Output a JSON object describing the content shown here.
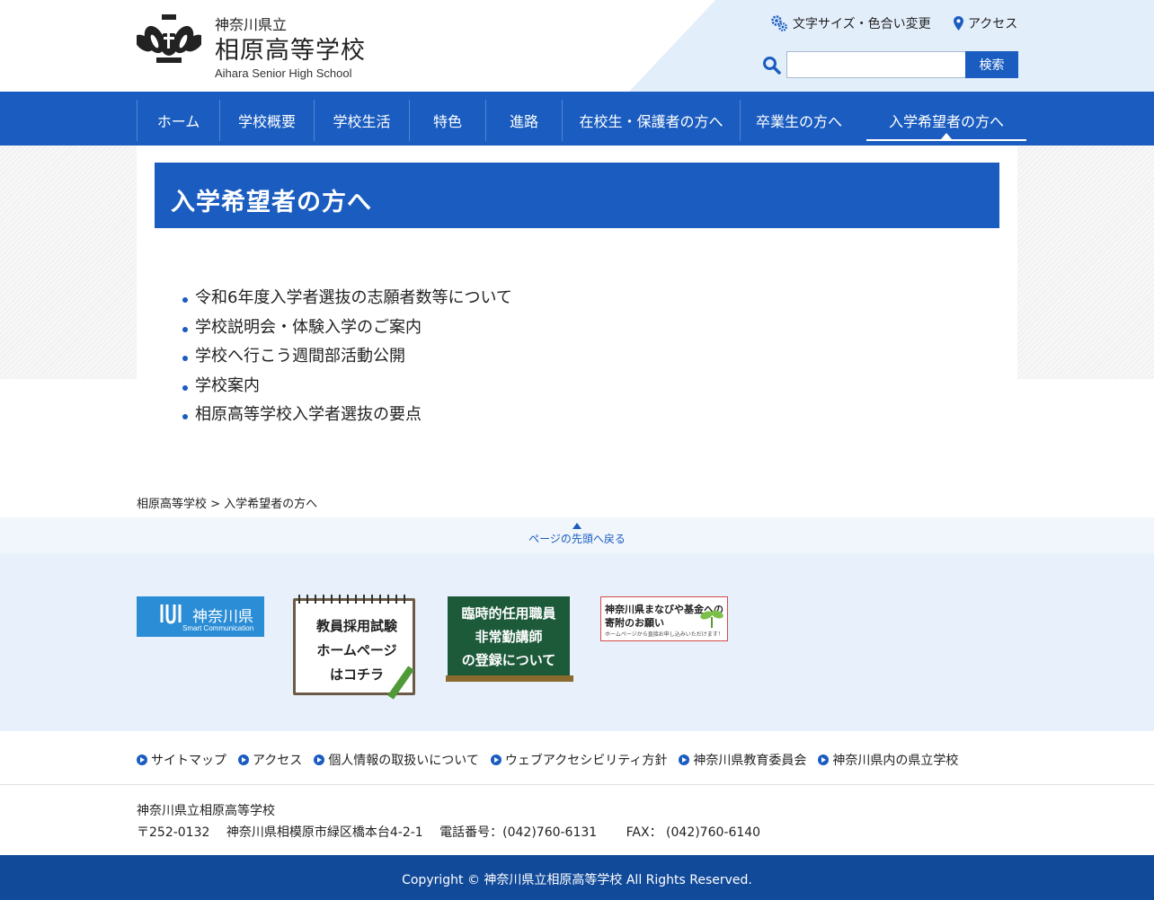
{
  "header": {
    "prefecture": "神奈川県立",
    "school_name": "相原高等学校",
    "school_name_en": "Aihara Senior High School",
    "util_font_color": "文字サイズ・色合い変更",
    "util_access": "アクセス",
    "search_placeholder": "",
    "search_button": "検索"
  },
  "nav": [
    {
      "label": "ホーム"
    },
    {
      "label": "学校概要"
    },
    {
      "label": "学校生活"
    },
    {
      "label": "特色"
    },
    {
      "label": "進路"
    },
    {
      "label": "在校生・保護者の方へ"
    },
    {
      "label": "卒業生の方へ"
    },
    {
      "label": "入学希望者の方へ",
      "active": true
    }
  ],
  "main": {
    "title": "入学希望者の方へ",
    "links": [
      "令和6年度入学者選抜の志願者数等について",
      "学校説明会・体験入学のご案内",
      "学校へ行こう週間部活動公開",
      "学校案内",
      "相原高等学校入学者選抜の要点"
    ]
  },
  "breadcrumb": "相原高等学校 > 入学希望者の方へ",
  "to_top": "ページの先頭へ戻る",
  "banners": {
    "kanagawa_main": "神奈川県",
    "kanagawa_sub": "Smart Communication",
    "recruit_lines": [
      "教員採用試験",
      "ホームページ",
      "はコチラ"
    ],
    "board_lines": [
      "臨時的任用職員",
      "非常勤講師",
      "の登録について"
    ],
    "fund_line1": "神奈川県まなびや基金への",
    "fund_line2": "寄附のお願い",
    "fund_line3": "ホームページから直接お申し込みいただけます！"
  },
  "footer_links": [
    "サイトマップ",
    "アクセス",
    "個人情報の取扱いについて",
    "ウェブアクセシビリティ方針",
    "神奈川県教育委員会",
    "神奈川県内の県立学校"
  ],
  "address": {
    "name": "神奈川県立相原高等学校",
    "postal": "〒252-0132",
    "street": "神奈川県相模原市緑区橋本台4-2-1",
    "phone": "電話番号：(042)760-6131",
    "fax": "FAX： (042)760-6140"
  },
  "copyright": "Copyright © 神奈川県立相原高等学校 All Rights Reserved.",
  "colors": {
    "primary": "#1a5cc0",
    "header_tint": "#e3eefb",
    "footer_dark": "#124a9a"
  }
}
